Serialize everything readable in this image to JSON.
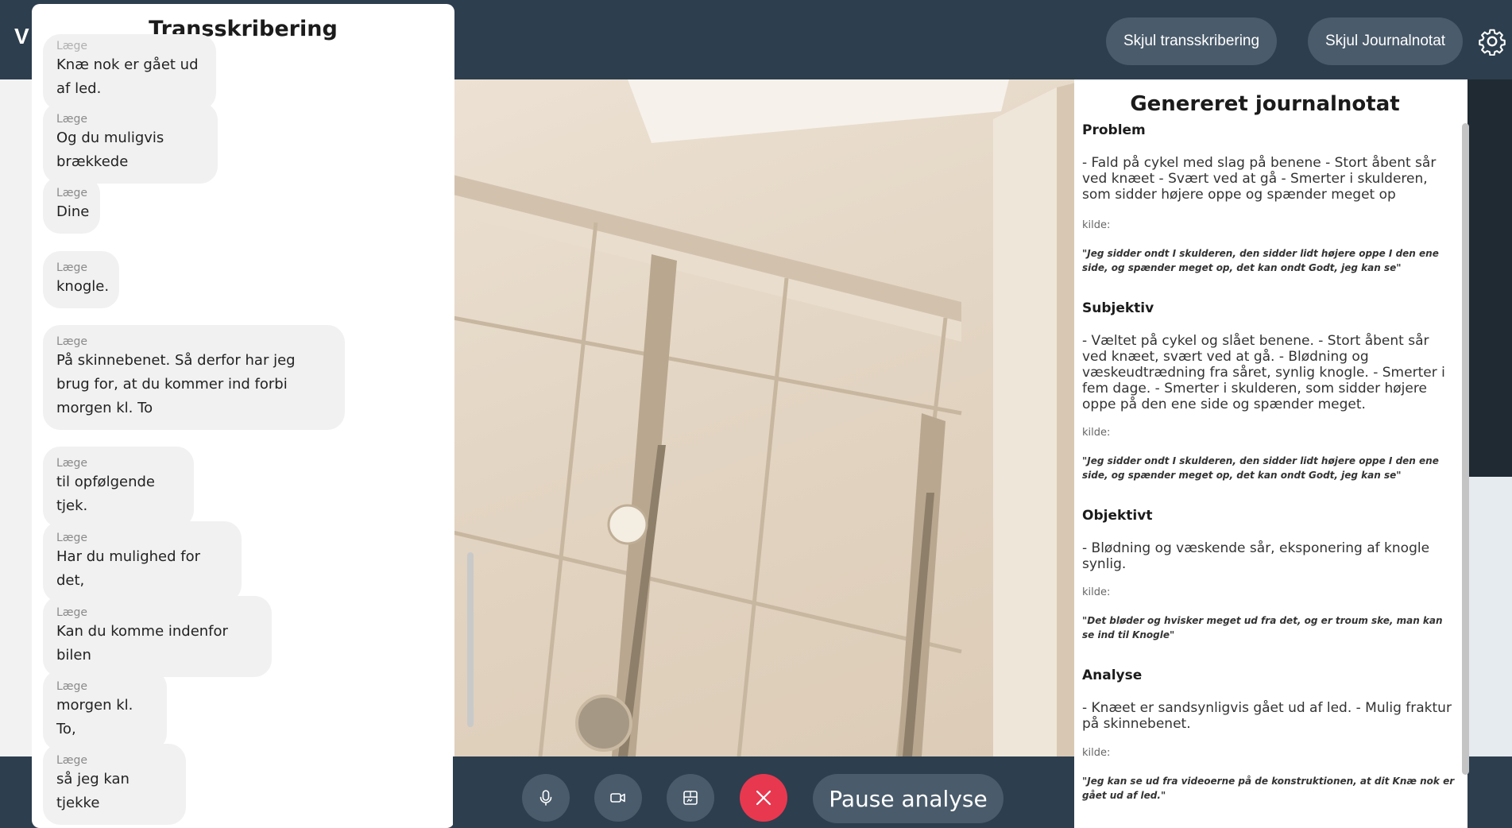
{
  "app": {
    "title_fragment": "V"
  },
  "header": {
    "hide_transcript_label": "Skjul transskribering",
    "hide_journal_label": "Skjul Journalnotat",
    "settings_icon": "gear-icon"
  },
  "transcript": {
    "title": "Transskribering",
    "messages": [
      {
        "speaker": "Læge",
        "text": "Knæ nok er gået ud af led."
      },
      {
        "speaker": "Læge",
        "text": "Og du muligvis brækkede"
      },
      {
        "speaker": "Læge",
        "text": "Dine"
      },
      {
        "speaker": "Læge",
        "text": "knogle."
      },
      {
        "speaker": "Læge",
        "text": "På skinnebenet. Så derfor har jeg brug for, at du kommer ind forbi morgen kl. To"
      },
      {
        "speaker": "Læge",
        "text": "til opfølgende tjek."
      },
      {
        "speaker": "Læge",
        "text": "Har du mulighed for det,"
      },
      {
        "speaker": "Læge",
        "text": "Kan du komme indenfor bilen"
      },
      {
        "speaker": "Læge",
        "text": "morgen kl. To,"
      },
      {
        "speaker": "Læge",
        "text": "så jeg kan tjekke"
      }
    ]
  },
  "journal": {
    "title": "Genereret journalnotat",
    "source_label": "kilde:",
    "sections": [
      {
        "heading": "Problem",
        "body": "- Fald på cykel med slag på benene - Stort åbent sår ved knæet - Svært ved at gå - Smerter i skulderen, som sidder højere oppe og spænder meget op",
        "quote": "\"Jeg sidder ondt I skulderen, den sidder lidt højere oppe I den ene side, og spænder meget op, det kan ondt Godt, jeg kan se\""
      },
      {
        "heading": "Subjektiv",
        "body": "- Væltet på cykel og slået benene. - Stort åbent sår ved knæet, svært ved at gå. - Blødning og væskeudtrædning fra såret, synlig knogle. - Smerter i fem dage. - Smerter i skulderen, som sidder højere oppe på den ene side og spænder meget.",
        "quote": "\"Jeg sidder ondt I skulderen, den sidder lidt højere oppe I den ene side, og spænder meget op, det kan ondt Godt, jeg kan se\""
      },
      {
        "heading": "Objektivt",
        "body": "- Blødning og væskende sår, eksponering af knogle synlig.",
        "quote": "\"Det bløder og hvisker meget ud fra det, og er troum ske, man kan se ind til Knogle\""
      },
      {
        "heading": "Analyse",
        "body": "- Knæet er sandsynligvis gået ud af led. - Mulig fraktur på skinnebenet.",
        "quote": "\"Jeg kan se ud fra videoerne på de konstruktionen, at dit Knæ nok er gået ud af led.\""
      }
    ]
  },
  "controls": {
    "mic_icon": "microphone-icon",
    "camera_icon": "camera-icon",
    "share_icon": "screen-share-icon",
    "end_icon": "close-icon",
    "pause_label": "Pause analyse"
  },
  "colors": {
    "header_bg": "#2d3e4e",
    "button_bg": "#4a5b6b",
    "end_call": "#e8384f",
    "bubble_bg": "#f1f1f1"
  }
}
